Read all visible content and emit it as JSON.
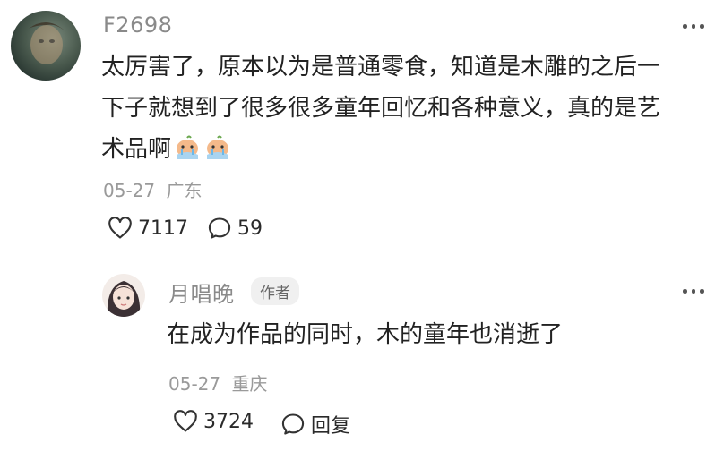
{
  "comments": [
    {
      "username": "F2698",
      "lines": [
        "太厉害了，原本以为是普通零食，知道是木雕的之后一",
        "下子就想到了很多很多童年回忆和各种意义，真的是艺",
        "术品啊"
      ],
      "emojis": [
        "crying-emoji",
        "crying-emoji"
      ],
      "date": "05-27",
      "location": "广东",
      "likes": "7117",
      "replies": "59"
    },
    {
      "username": "月唱晚",
      "author_badge": "作者",
      "text": "在成为作品的同时，木的童年也消逝了",
      "date": "05-27",
      "location": "重庆",
      "likes": "3724",
      "reply_label": "回复"
    }
  ],
  "icons": {
    "like": "heart-outline-icon",
    "comment": "speech-bubble-icon",
    "more": "more-dots-icon"
  }
}
